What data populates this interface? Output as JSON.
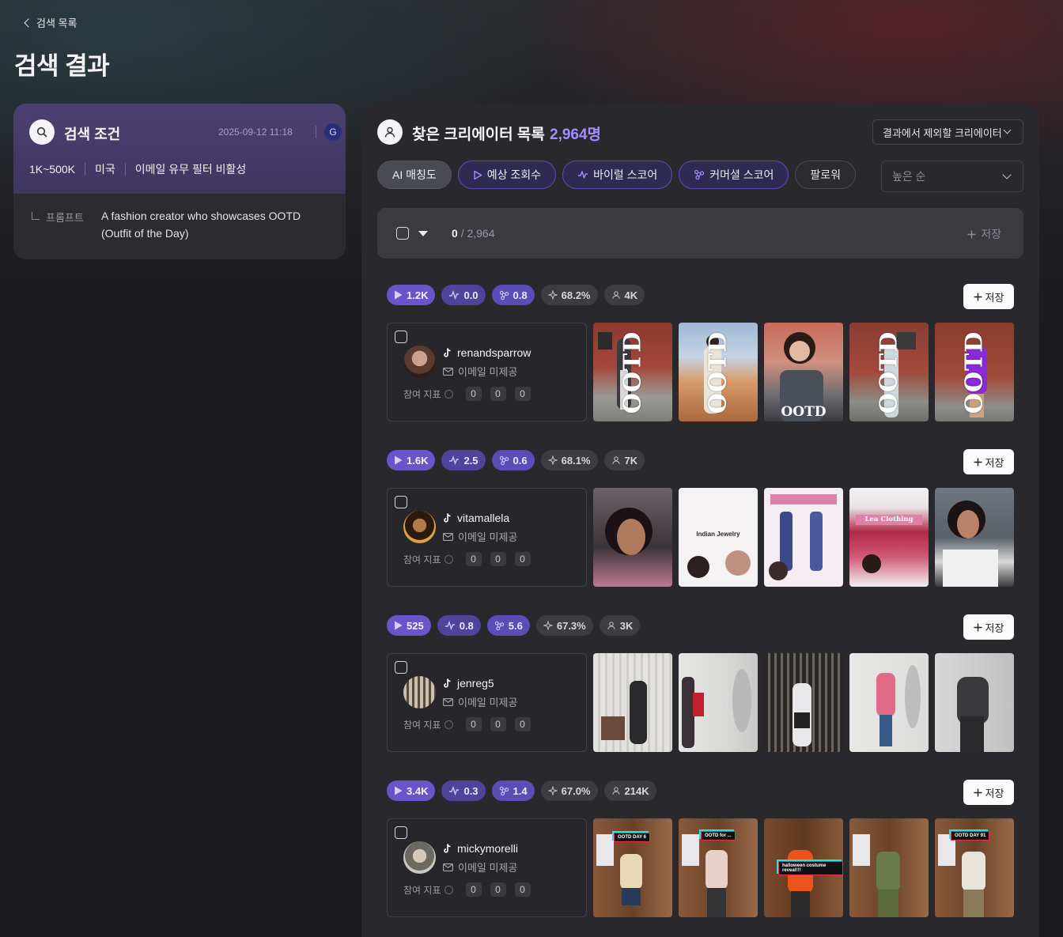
{
  "nav": {
    "back_label": "검색 목록"
  },
  "page": {
    "title": "검색 결과"
  },
  "conditions": {
    "title": "검색 조건",
    "date": "2025-09-12 11:18",
    "user_initial": "G",
    "tags": [
      "1K~500K",
      "미국",
      "이메일 유무 필터 비활성"
    ],
    "prompt_label": "프롬프트",
    "prompt_text": "A fashion creator who showcases OOTD (Outfit of the Day)"
  },
  "results": {
    "title": "찾은 크리에이터 목록",
    "count": "2,964명",
    "exclude_label": "결과에서 제외할 크리에이터",
    "filters": [
      {
        "label": "AI 매칭도",
        "icon": "",
        "style": "active"
      },
      {
        "label": "예상 조회수",
        "icon": "play-icon",
        "style": "purple"
      },
      {
        "label": "바이럴 스코어",
        "icon": "pulse-icon",
        "style": "purple"
      },
      {
        "label": "커머셜 스코어",
        "icon": "network-icon",
        "style": "purple"
      },
      {
        "label": "팔로워",
        "icon": "",
        "style": "plain"
      }
    ],
    "sort_placeholder": "높은 순",
    "selected": "0",
    "total": "/ 2,964",
    "save_label": "저장"
  },
  "creators": [
    {
      "views": "1.2K",
      "viral": "0.0",
      "commercial": "0.8",
      "match": "68.2%",
      "followers": "4K",
      "handle": "renandsparrow",
      "email": "이메일 미제공",
      "engage_label": "참여 지표",
      "engage": [
        "0",
        "0",
        "0"
      ],
      "save_label": "저장",
      "thumb_texts": [
        "OOTD",
        "OOTD",
        "OOTD",
        "OOTD",
        "OOTD"
      ]
    },
    {
      "views": "1.6K",
      "viral": "2.5",
      "commercial": "0.6",
      "match": "68.1%",
      "followers": "7K",
      "handle": "vitamallela",
      "email": "이메일 미제공",
      "engage_label": "참여 지표",
      "engage": [
        "0",
        "0",
        "0"
      ],
      "save_label": "저장",
      "thumb_texts": [
        "Indian Jewelry",
        "Lea Clothing"
      ]
    },
    {
      "views": "525",
      "viral": "0.8",
      "commercial": "5.6",
      "match": "67.3%",
      "followers": "3K",
      "handle": "jenreg5",
      "email": "이메일 미제공",
      "engage_label": "참여 지표",
      "engage": [
        "0",
        "0",
        "0"
      ],
      "save_label": "저장",
      "thumb_texts": []
    },
    {
      "views": "3.4K",
      "viral": "0.3",
      "commercial": "1.4",
      "match": "67.0%",
      "followers": "214K",
      "handle": "mickymorelli",
      "email": "이메일 미제공",
      "engage_label": "참여 지표",
      "engage": [
        "0",
        "0",
        "0"
      ],
      "save_label": "저장",
      "thumb_texts": [
        "OOTD DAY 6",
        "OOTD for ...",
        "halloween costume reveal!!!",
        "OOTD DAY 91"
      ]
    }
  ],
  "colors": {
    "accent": "#a38dff",
    "pill_views": "#6a55c8",
    "pill_viral": "#4f439a",
    "header_card": "#4c4070"
  }
}
